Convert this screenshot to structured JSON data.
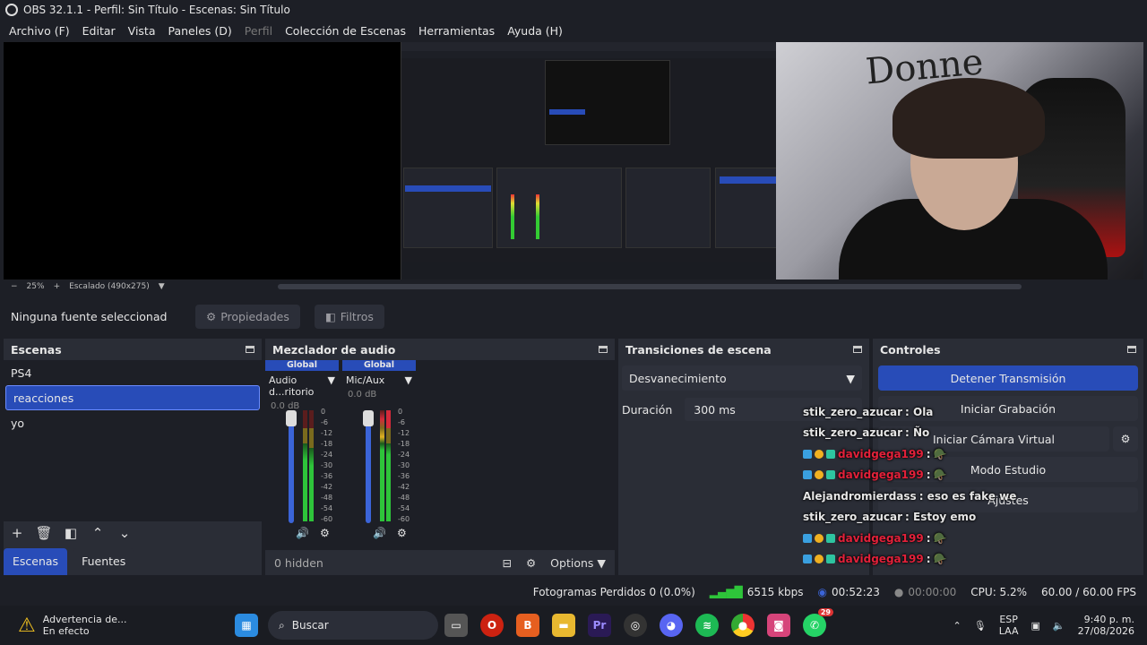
{
  "window": {
    "title": "OBS 32.1.1 - Perfil: Sin Título - Escenas: Sin Título"
  },
  "menu": [
    {
      "label": "Archivo (F)",
      "enabled": true
    },
    {
      "label": "Editar",
      "enabled": true
    },
    {
      "label": "Vista",
      "enabled": true
    },
    {
      "label": "Paneles (D)",
      "enabled": true
    },
    {
      "label": "Perfil",
      "enabled": false
    },
    {
      "label": "Colección de Escenas",
      "enabled": true
    },
    {
      "label": "Herramientas",
      "enabled": true
    },
    {
      "label": "Ayuda (H)",
      "enabled": true
    }
  ],
  "preview": {
    "zoom": "25%",
    "scaling": "Escalado (490x275)",
    "graffiti_text": "Donne"
  },
  "source_bar": {
    "no_source": "Ninguna fuente seleccionad",
    "properties": "Propiedades",
    "filters": "Filtros"
  },
  "scenes": {
    "title": "Escenas",
    "items": [
      "PS4",
      "reacciones",
      "yo"
    ],
    "selected": "reacciones"
  },
  "bottom_tabs": {
    "scenes": "Escenas",
    "sources": "Fuentes"
  },
  "mixer": {
    "title": "Mezclador de audio",
    "channels": [
      {
        "group": "Global",
        "name": "Audio d...ritorio",
        "db": "0.0 dB"
      },
      {
        "group": "Global",
        "name": "Mic/Aux",
        "db": "0.0 dB"
      }
    ],
    "ticks": [
      "0",
      "-6",
      "-12",
      "-18",
      "-24",
      "-30",
      "-36",
      "-42",
      "-48",
      "-54",
      "-60"
    ],
    "hidden": "0 hidden",
    "options": "Options"
  },
  "transitions": {
    "title": "Transiciones de escena",
    "selected": "Desvanecimiento",
    "duration_label": "Duración",
    "duration_value": "300 ms"
  },
  "controls": {
    "title": "Controles",
    "stop_stream": "Detener Transmisión",
    "start_recording": "Iniciar Grabación",
    "start_virtual_cam": "Iniciar Cámara Virtual",
    "studio_mode": "Modo Estudio",
    "settings": "Ajustes"
  },
  "chat": [
    {
      "user": "stik_zero_azucar",
      "text": ": Ola",
      "style": "plain"
    },
    {
      "user": "stik_zero_azucar",
      "text": ": Ño",
      "style": "plain"
    },
    {
      "user": "davidgega199",
      "text": ":",
      "style": "badges-red"
    },
    {
      "user": "davidgega199",
      "text": ":",
      "style": "badges-red"
    },
    {
      "user": "Alejandromierdass",
      "text": ": eso es fake we",
      "style": "plain"
    },
    {
      "user": "stik_zero_azucar",
      "text": ": Estoy emo",
      "style": "plain"
    },
    {
      "user": "davidgega199",
      "text": ":",
      "style": "badges-red"
    },
    {
      "user": "davidgega199",
      "text": ":",
      "style": "badges-red"
    }
  ],
  "status": {
    "dropped_frames": "Fotogramas Perdidos 0 (0.0%)",
    "bitrate": "6515 kbps",
    "stream_time": "00:52:23",
    "rec_time": "00:00:00",
    "cpu": "CPU: 5.2%",
    "fps": "60.00 / 60.00 FPS"
  },
  "taskbar": {
    "warning_title": "Advertencia de...",
    "warning_sub": "En efecto",
    "search": "Buscar",
    "lang": "ESP",
    "lang_sub": "LAA",
    "time": "9:40 p. m.",
    "date": "27/08/2026",
    "discord_badge": "",
    "whatsapp_badge": "29"
  },
  "colors": {
    "accent": "#284cb8",
    "panel": "#2a2d36",
    "background": "#1d1f26",
    "chat_red": "#e2213a"
  }
}
